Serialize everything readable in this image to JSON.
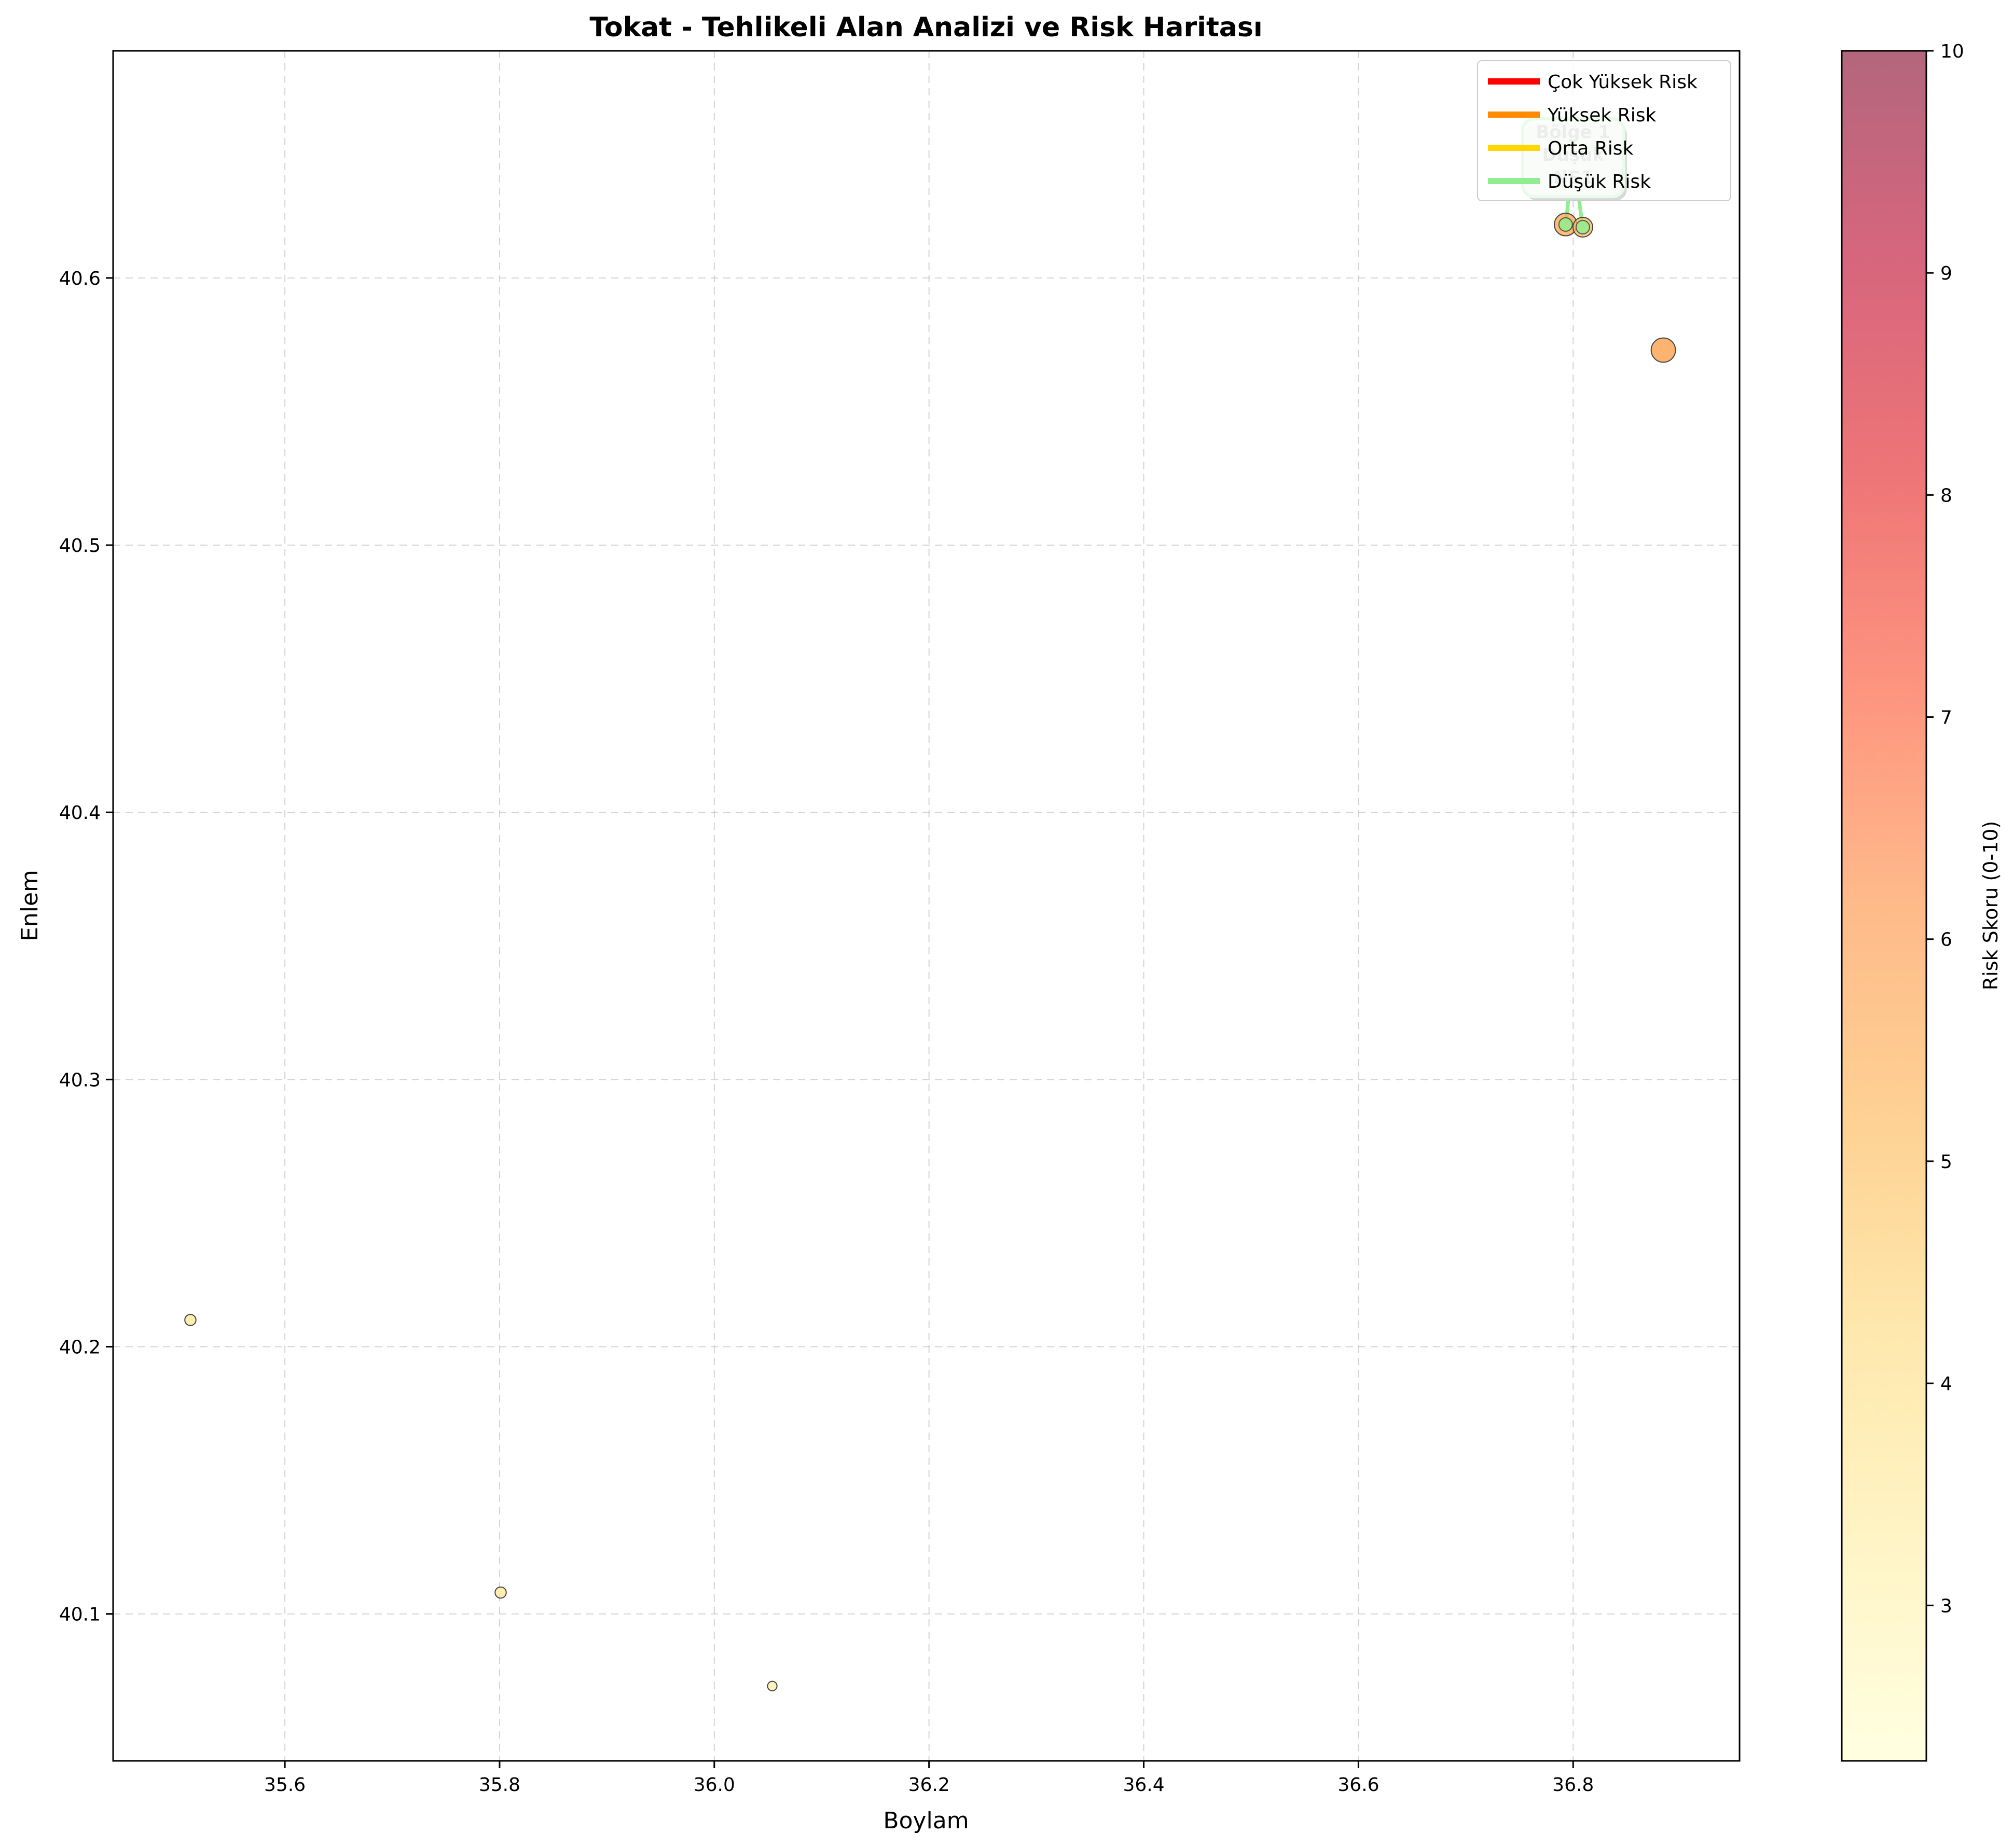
{
  "chart_data": {
    "type": "scatter",
    "title": "Tokat - Tehlikeli Alan Analizi ve Risk Haritası",
    "xlabel": "Boylam",
    "ylabel": "Enlem",
    "xlim": [
      35.44,
      36.955
    ],
    "ylim": [
      40.045,
      40.685
    ],
    "xticks": [
      35.6,
      35.8,
      36.0,
      36.2,
      36.4,
      36.6,
      36.8
    ],
    "xtick_labels": [
      "35.6",
      "35.8",
      "36.0",
      "36.2",
      "36.4",
      "36.6",
      "36.8"
    ],
    "yticks": [
      40.1,
      40.2,
      40.3,
      40.4,
      40.5,
      40.6
    ],
    "ytick_labels": [
      "40.1",
      "40.2",
      "40.3",
      "40.4",
      "40.5",
      "40.6"
    ],
    "grid": true,
    "points": [
      {
        "x": 35.512,
        "y": 40.21,
        "risk": 3.5
      },
      {
        "x": 35.801,
        "y": 40.108,
        "risk": 3.5
      },
      {
        "x": 36.054,
        "y": 40.073,
        "risk": 3.2
      },
      {
        "x": 36.884,
        "y": 40.573,
        "risk": 5.8
      },
      {
        "x": 36.793,
        "y": 40.62,
        "risk": 5.5
      },
      {
        "x": 36.809,
        "y": 40.619,
        "risk": 5.0
      }
    ],
    "low_risk_markers": [
      {
        "x": 36.793,
        "y": 40.62
      },
      {
        "x": 36.809,
        "y": 40.619
      }
    ],
    "annotation": {
      "lines": [
        "Bölge 1",
        "Düşük",
        "NS1"
      ],
      "x": 36.8,
      "y": 40.645,
      "color": "#90ee90"
    },
    "legend": {
      "placement": "upper right",
      "entries": [
        {
          "label": "Çok Yüksek Risk",
          "color": "#ff0000"
        },
        {
          "label": "Yüksek Risk",
          "color": "#ff8c00"
        },
        {
          "label": "Orta Risk",
          "color": "#ffd700"
        },
        {
          "label": "Düşük Risk",
          "color": "#90ee90"
        }
      ]
    },
    "colorbar": {
      "label": "Risk Skoru (0-10)",
      "min": 2.3,
      "max": 10,
      "ticks": [
        3,
        4,
        5,
        6,
        7,
        8,
        9,
        10
      ],
      "tick_labels": [
        "3",
        "4",
        "5",
        "6",
        "7",
        "8",
        "9",
        "10"
      ],
      "colormap": "YlOrRd",
      "alpha": 0.6
    }
  }
}
